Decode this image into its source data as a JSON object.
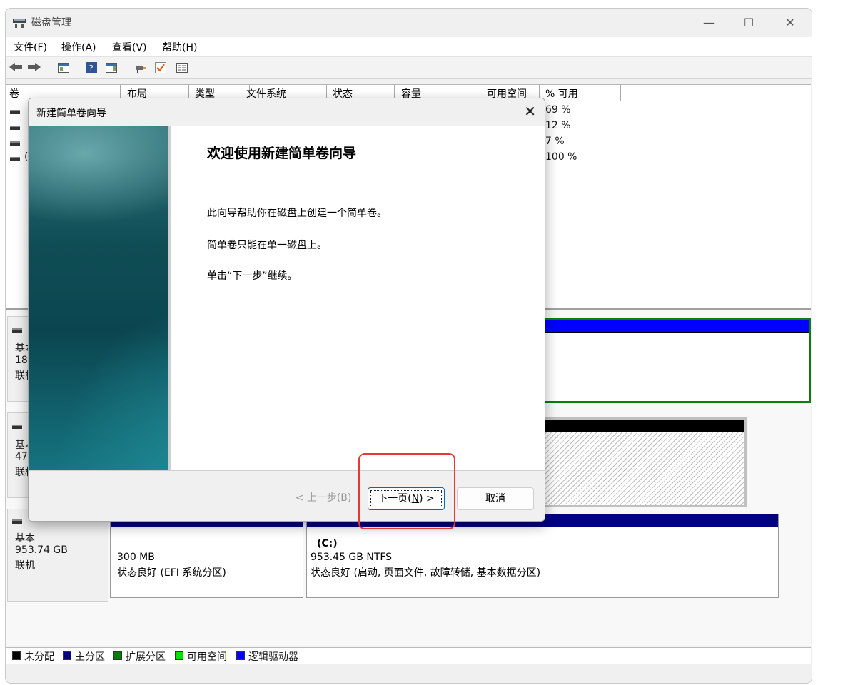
{
  "window": {
    "title": "磁盘管理",
    "controls": {
      "minimize": "—",
      "maximize": "☐",
      "close": "✕"
    }
  },
  "menu": [
    "文件(F)",
    "操作(A)",
    "查看(V)",
    "帮助(H)"
  ],
  "toolbar": {
    "icons": [
      "back-arrow",
      "forward-arrow",
      "console-tree",
      "help",
      "action-pane",
      "connect",
      "checklist",
      "properties"
    ]
  },
  "volume_table": {
    "columns": [
      "卷",
      "布局",
      "类型",
      "文件系统",
      "状态",
      "容量",
      "可用空间",
      "% 可用"
    ],
    "rows": [
      {
        "volume": "",
        "pct_free": "69 %"
      },
      {
        "volume": "",
        "pct_free": "12 %"
      },
      {
        "volume": "",
        "pct_free": "7 %"
      },
      {
        "volume": "(",
        "pct_free": "100 %"
      }
    ]
  },
  "disks": [
    {
      "label_lines": [
        "基本",
        "18",
        "联机"
      ]
    },
    {
      "label_lines": [
        "基本",
        "47",
        "联机"
      ]
    },
    {
      "label_lines": [
        "基本",
        "953.74 GB",
        "联机"
      ],
      "partitions": [
        {
          "name": "",
          "size": "300 MB",
          "status": "状态良好 (EFI 系统分区)"
        },
        {
          "name": "(C:)",
          "size": "953.45 GB NTFS",
          "status": "状态良好 (启动, 页面文件, 故障转储, 基本数据分区)"
        }
      ]
    }
  ],
  "legend": [
    {
      "label": "未分配",
      "color": "#000000"
    },
    {
      "label": "主分区",
      "color": "#000080"
    },
    {
      "label": "扩展分区",
      "color": "#008000"
    },
    {
      "label": "可用空间",
      "color": "#00e000"
    },
    {
      "label": "逻辑驱动器",
      "color": "#0000ff"
    }
  ],
  "wizard": {
    "title": "新建简单卷向导",
    "close": "✕",
    "heading": "欢迎使用新建简单卷向导",
    "paragraphs": [
      "此向导帮助你在磁盘上创建一个简单卷。",
      "简单卷只能在单一磁盘上。",
      "单击“下一步”继续。"
    ],
    "buttons": {
      "back": "< 上一步(B)",
      "next_pre": "下一页(",
      "next_key": "N",
      "next_post": ") >",
      "cancel": "取消"
    }
  }
}
